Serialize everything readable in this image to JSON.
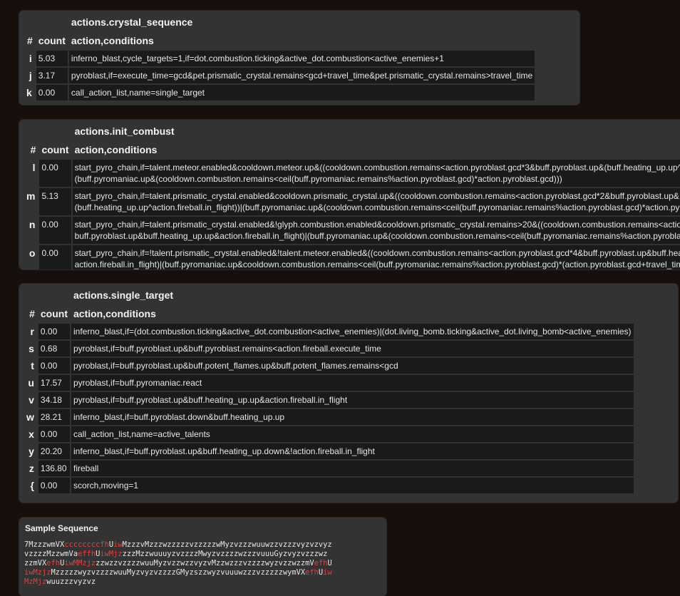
{
  "panels": [
    {
      "title": "actions.crystal_sequence",
      "headers": {
        "index": "#",
        "count": "count",
        "action": "action,conditions"
      },
      "rows": [
        {
          "id": "i",
          "count": "5.03",
          "lines": [
            "inferno_blast,cycle_targets=1,if=dot.combustion.ticking&active_dot.combustion<active_enemies+1"
          ]
        },
        {
          "id": "j",
          "count": "3.17",
          "lines": [
            "pyroblast,if=execute_time=gcd&pet.prismatic_crystal.remains<gcd+travel_time&pet.prismatic_crystal.remains>travel_time"
          ]
        },
        {
          "id": "k",
          "count": "0.00",
          "lines": [
            "call_action_list,name=single_target"
          ]
        }
      ]
    },
    {
      "title": "actions.init_combust",
      "headers": {
        "index": "#",
        "count": "count",
        "action": "action,conditions"
      },
      "rows": [
        {
          "id": "l",
          "count": "0.00",
          "lines": [
            "start_pyro_chain,if=talent.meteor.enabled&cooldown.meteor.up&((cooldown.combustion.remains<action.pyroblast.gcd*3&buff.pyroblast.up&(buff.heating_up.up^action.fireball.in_flight))|",
            "(buff.pyromaniac.up&(cooldown.combustion.remains<ceil(buff.pyromaniac.remains%action.pyroblast.gcd)*action.pyroblast.gcd)))"
          ]
        },
        {
          "id": "m",
          "count": "5.13",
          "lines": [
            "start_pyro_chain,if=talent.prismatic_crystal.enabled&cooldown.prismatic_crystal.up&((cooldown.combustion.remains<action.pyroblast.gcd*2&buff.pyroblast.up&",
            "(buff.heating_up.up^action.fireball.in_flight))|(buff.pyromaniac.up&(cooldown.combustion.remains<ceil(buff.pyromaniac.remains%action.pyroblast.gcd)*action.pyroblast.gcd)))"
          ]
        },
        {
          "id": "n",
          "count": "0.00",
          "lines": [
            "start_pyro_chain,if=talent.prismatic_crystal.enabled&!glyph.combustion.enabled&cooldown.prismatic_crystal.remains>20&((cooldown.combustion.remains<action.pyroblast.gcd*2&",
            "buff.pyroblast.up&buff.heating_up.up&action.fireball.in_flight)|(buff.pyromaniac.up&(cooldown.combustion.remains<ceil(buff.pyromaniac.remains%action.pyroblast.gcd)*action.pyroblast.gcd)))"
          ]
        },
        {
          "id": "o",
          "count": "0.00",
          "lines": [
            "start_pyro_chain,if=!talent.prismatic_crystal.enabled&!talent.meteor.enabled&((cooldown.combustion.remains<action.pyroblast.gcd*4&buff.pyroblast.up&buff.heating_up.up&",
            "action.fireball.in_flight)|(buff.pyromaniac.up&cooldown.combustion.remains<ceil(buff.pyromaniac.remains%action.pyroblast.gcd)*(action.pyroblast.gcd+travel_time)))"
          ]
        }
      ]
    },
    {
      "title": "actions.single_target",
      "headers": {
        "index": "#",
        "count": "count",
        "action": "action,conditions"
      },
      "rows": [
        {
          "id": "r",
          "count": "0.00",
          "lines": [
            "inferno_blast,if=(dot.combustion.ticking&active_dot.combustion<active_enemies)|(dot.living_bomb.ticking&active_dot.living_bomb<active_enemies)"
          ]
        },
        {
          "id": "s",
          "count": "0.68",
          "lines": [
            "pyroblast,if=buff.pyroblast.up&buff.pyroblast.remains<action.fireball.execute_time"
          ]
        },
        {
          "id": "t",
          "count": "0.00",
          "lines": [
            "pyroblast,if=buff.pyroblast.up&buff.potent_flames.up&buff.potent_flames.remains<gcd"
          ]
        },
        {
          "id": "u",
          "count": "17.57",
          "lines": [
            "pyroblast,if=buff.pyromaniac.react"
          ]
        },
        {
          "id": "v",
          "count": "34.18",
          "lines": [
            "pyroblast,if=buff.pyroblast.up&buff.heating_up.up&action.fireball.in_flight"
          ]
        },
        {
          "id": "w",
          "count": "28.21",
          "lines": [
            "inferno_blast,if=buff.pyroblast.down&buff.heating_up.up"
          ]
        },
        {
          "id": "x",
          "count": "0.00",
          "lines": [
            "call_action_list,name=active_talents"
          ]
        },
        {
          "id": "y",
          "count": "20.20",
          "lines": [
            "inferno_blast,if=buff.pyroblast.up&buff.heating_up.down&!action.fireball.in_flight"
          ]
        },
        {
          "id": "z",
          "count": "136.80",
          "lines": [
            "fireball"
          ]
        },
        {
          "id": "{",
          "count": "0.00",
          "lines": [
            "scorch,moving=1"
          ]
        }
      ]
    }
  ],
  "sample_sequence": {
    "title": "Sample Sequence",
    "highlight_color": "#e04040",
    "lines": [
      [
        [
          "7MzzzwmVX",
          false
        ],
        [
          "ccccccccfh",
          true
        ],
        [
          "U",
          false
        ],
        [
          "iw",
          true
        ],
        [
          "MzzzvMzzzwzzzzzvzzzzzwMyzvzzzwuuwzzvzzzvyzvzvyz",
          false
        ]
      ],
      [
        [
          "vzzzzMzzwmVa",
          false
        ],
        [
          "effh",
          true
        ],
        [
          "U",
          false
        ],
        [
          "iwMjz",
          true
        ],
        [
          "zzzMzzwuuuyzvzzzzMwyzvzzzzwzzzvuuuGyzvyzvzzzwz",
          false
        ]
      ],
      [
        [
          "zzmVX",
          false
        ],
        [
          "efh",
          true
        ],
        [
          "U",
          false
        ],
        [
          "iwMMzjz",
          true
        ],
        [
          "zzwzzvzzzzwuuMyzvzzwzzvyzvMzzwzzzvzzzzwyzvzzwzzmV",
          false
        ],
        [
          "efh",
          true
        ],
        [
          "U",
          false
        ]
      ],
      [
        [
          "iwMzjz",
          true
        ],
        [
          "MzzzzzwyzvzzzzwuuMyzvyzvzzzzGMyzszzwyzvuuuwzzzvzzzzzwymVX",
          false
        ],
        [
          "efh",
          true
        ],
        [
          "U",
          false
        ],
        [
          "iw",
          true
        ]
      ],
      [
        [
          "MzMjz",
          true
        ],
        [
          "wuuzzzvyzvz",
          false
        ]
      ]
    ]
  }
}
